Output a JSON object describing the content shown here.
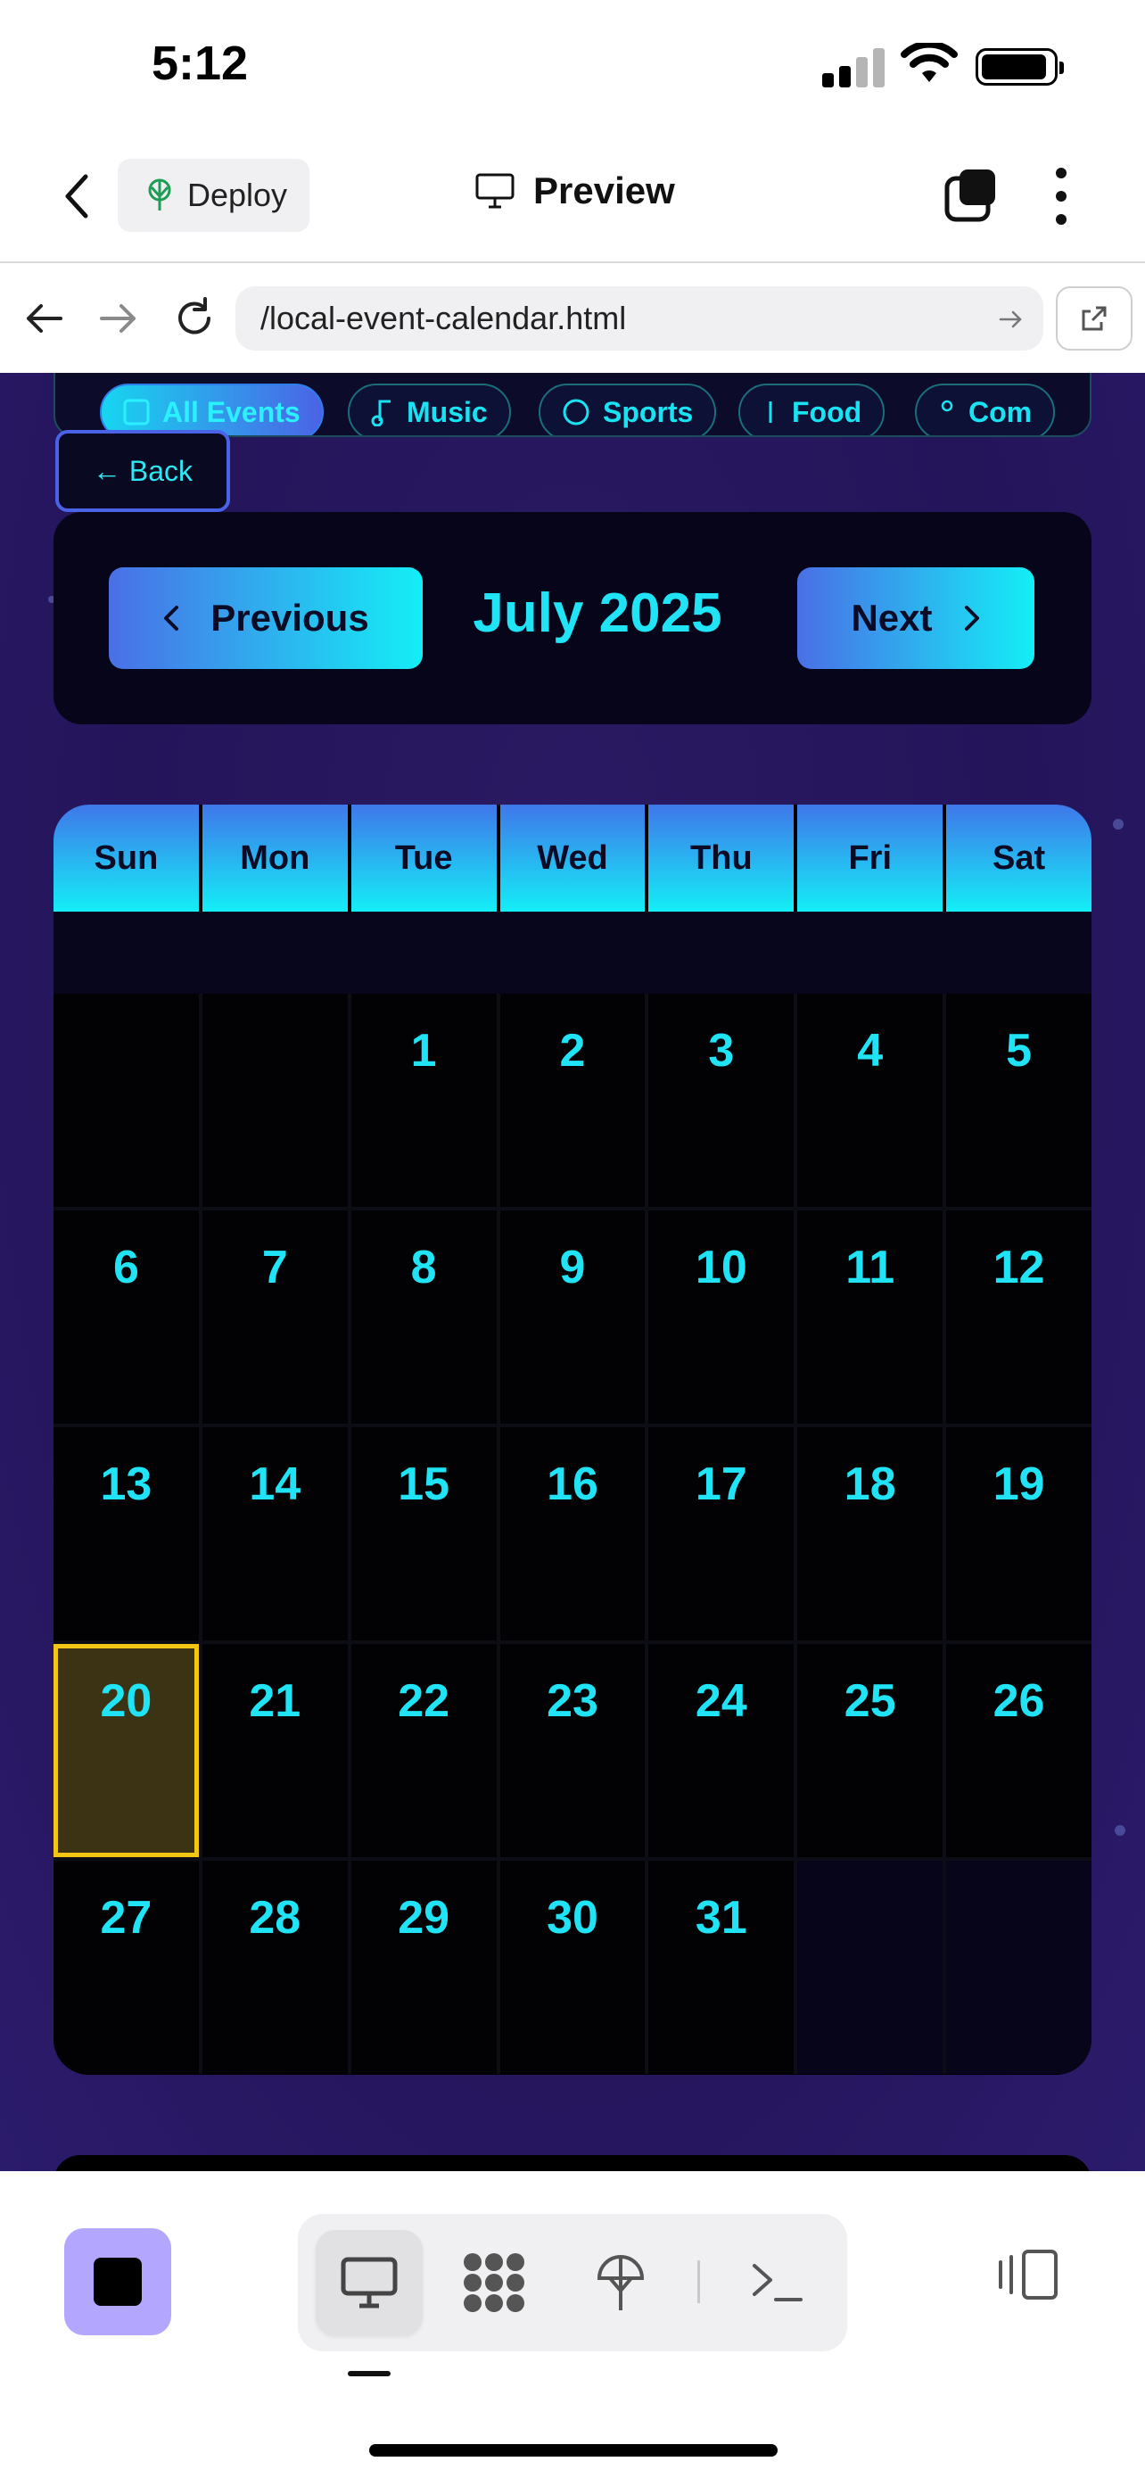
{
  "status": {
    "time": "5:12"
  },
  "app_bar": {
    "deploy_label": "Deploy",
    "preview_label": "Preview"
  },
  "browser": {
    "url": "/local-event-calendar.html"
  },
  "filters": [
    {
      "label": "All Events",
      "icon": "square-icon",
      "active": true
    },
    {
      "label": "Music",
      "icon": "music-note-icon",
      "active": false
    },
    {
      "label": "Sports",
      "icon": "circle-icon",
      "active": false
    },
    {
      "label": "Food",
      "icon": "bar-icon",
      "active": false
    },
    {
      "label": "Com",
      "icon": "dot-icon",
      "active": false
    }
  ],
  "back_label": "← Back",
  "calendar_nav": {
    "previous_label": "Previous",
    "next_label": "Next",
    "month_title": "July 2025"
  },
  "weekdays": [
    "Sun",
    "Mon",
    "Tue",
    "Wed",
    "Thu",
    "Fri",
    "Sat"
  ],
  "days": [
    "",
    "",
    "1",
    "2",
    "3",
    "4",
    "5",
    "6",
    "7",
    "8",
    "9",
    "10",
    "11",
    "12",
    "13",
    "14",
    "15",
    "16",
    "17",
    "18",
    "19",
    "20",
    "21",
    "22",
    "23",
    "24",
    "25",
    "26",
    "27",
    "28",
    "29",
    "30",
    "31",
    "",
    ""
  ],
  "today": "20",
  "colors": {
    "accent_cyan": "#20e4f5",
    "accent_blue": "#4a6fe6",
    "today_outline": "#f3c514",
    "background": "#24145a"
  },
  "toolbar": {
    "modes": [
      "monitor-icon",
      "grid-blob-icon",
      "deploy-icon",
      "terminal-icon"
    ],
    "active_mode": "monitor-icon"
  }
}
